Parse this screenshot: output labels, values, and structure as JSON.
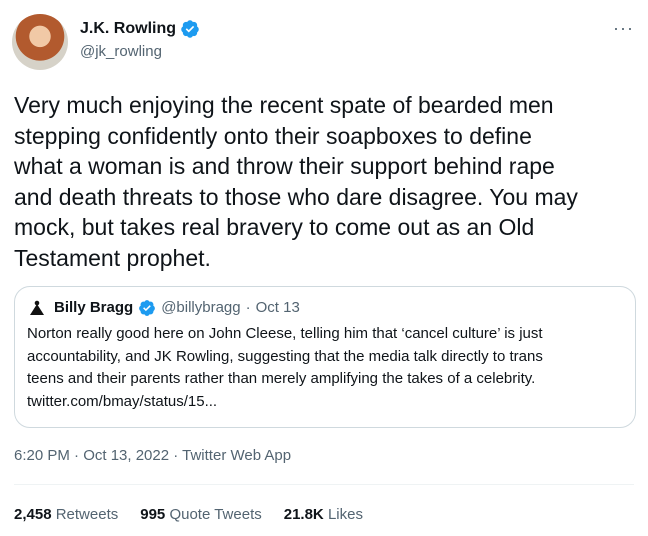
{
  "author": {
    "display_name": "J.K. Rowling",
    "handle": "@jk_rowling",
    "verified_color": "#1d9bf0"
  },
  "more_label": "···",
  "tweet_text": "Very much enjoying the recent spate of bearded men\nstepping confidently onto their soapboxes to define\nwhat a woman is and throw their support behind rape\nand death threats to those who dare disagree. You may\nmock, but takes real bravery to come out as an Old\nTestament prophet.",
  "quoted": {
    "display_name": "Billy Bragg",
    "handle": "@billybragg",
    "separator": "·",
    "date": "Oct 13",
    "text": "Norton really good here on John Cleese, telling him that ‘cancel culture’ is just\naccountability, and JK Rowling, suggesting that the media talk directly to trans\nteens and their parents rather than merely amplifying the takes of a celebrity.\ntwitter.com/bmay/status/15..."
  },
  "meta": "6:20 PM · Oct 13, 2022 · Twitter Web App",
  "stats": {
    "retweets_count": "2,458",
    "retweets_label": "Retweets",
    "quotes_count": "995",
    "quotes_label": "Quote Tweets",
    "likes_count": "21.8K",
    "likes_label": "Likes"
  }
}
